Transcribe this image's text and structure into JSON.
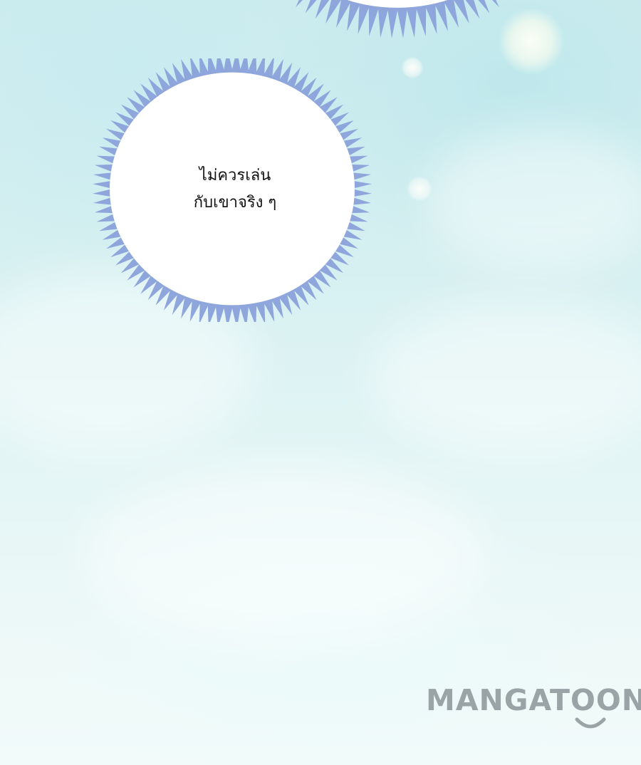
{
  "speech_bubble": {
    "lines": [
      "ไม่ควรเล่น",
      "กับเขาจริง ๆ"
    ]
  },
  "watermark": {
    "text": "MANGATOON"
  },
  "colors": {
    "bubble_spike": "#8ea6dc",
    "bubble_fill": "#ffffff",
    "logo": "#9aa3a6"
  }
}
